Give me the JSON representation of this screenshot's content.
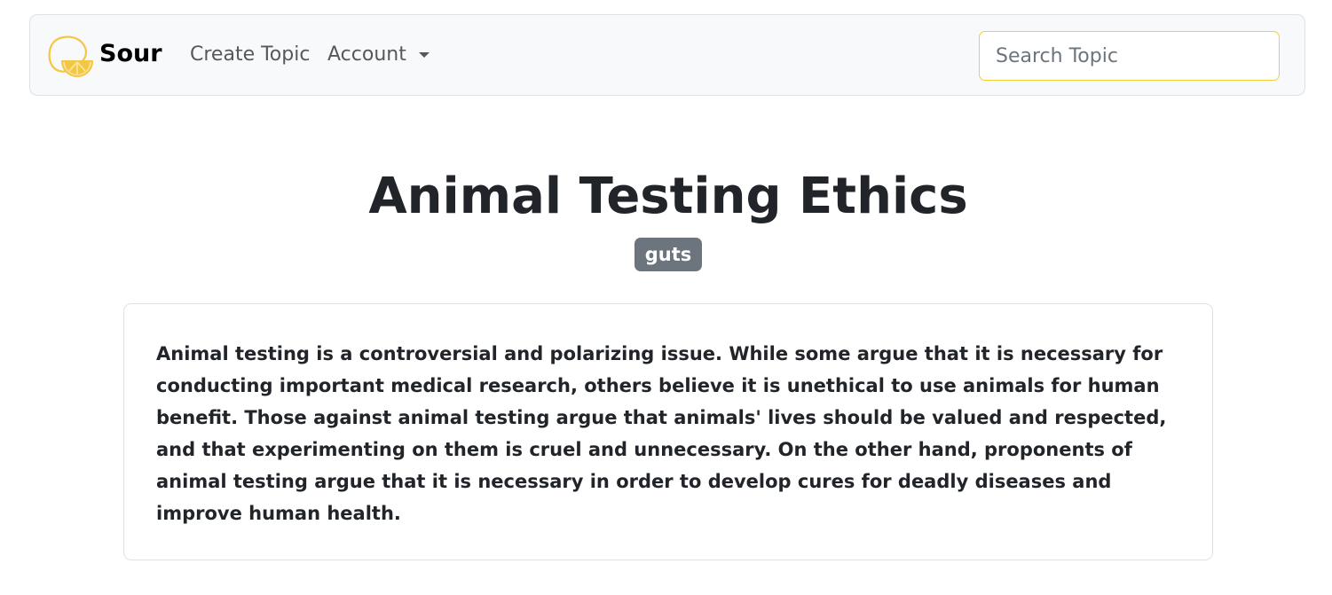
{
  "navbar": {
    "brand": "Sour",
    "brand_logo_icon": "lemon-slice-icon",
    "brand_color": "#f2c744",
    "links": {
      "create_topic": "Create Topic",
      "account": "Account"
    },
    "search": {
      "placeholder": "Search Topic",
      "value": ""
    }
  },
  "topic": {
    "title": "Animal Testing Ethics",
    "tag": "guts",
    "description": "Animal testing is a controversial and polarizing issue. While some argue that it is necessary for conducting important medical research, others believe it is unethical to use animals for human benefit. Those against animal testing argue that animals' lives should be valued and respected, and that experimenting on them is cruel and unnecessary. On the other hand, proponents of animal testing argue that it is necessary in order to develop cures for deadly diseases and improve human health."
  }
}
